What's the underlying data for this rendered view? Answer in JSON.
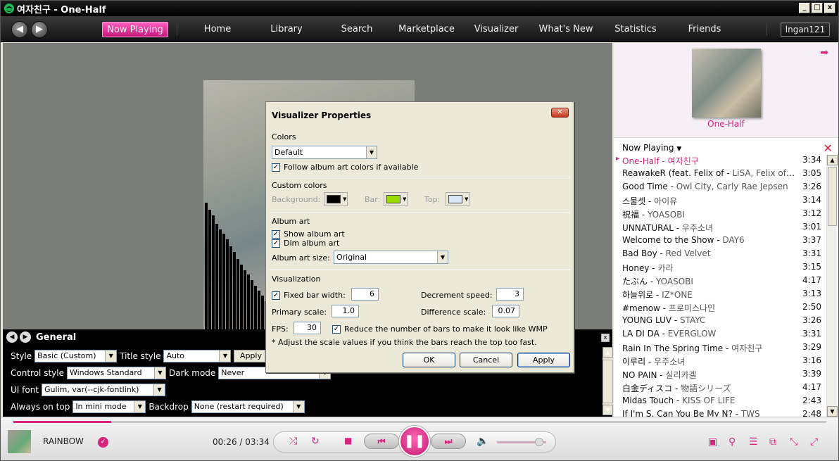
{
  "window": {
    "title": "여자친구 - One-Half",
    "controls": [
      "_",
      "□",
      "x"
    ]
  },
  "nav": {
    "back": "◀",
    "forward": "▶",
    "tabs": [
      "Now Playing",
      "Home",
      "Library",
      "Search",
      "Marketplace",
      "Visualizer",
      "What's New",
      "Statistics",
      "Friends"
    ],
    "user": "lngan121"
  },
  "settings": {
    "title": "General",
    "style_label": "Style",
    "style_value": "Basic (Custom)",
    "title_style_label": "Title style",
    "title_style_value": "Auto",
    "apply_label": "Apply",
    "control_style_label": "Control style",
    "control_style_value": "Windows Standard",
    "dark_mode_label": "Dark mode",
    "dark_mode_value": "Never",
    "ui_font_label": "UI font",
    "ui_font_value": "Gulim, var(--cjk-fontlink)",
    "always_on_top_label": "Always on top",
    "always_on_top_value": "In mini mode",
    "backdrop_label": "Backdrop",
    "backdrop_value": "None (restart required)"
  },
  "sidebar": {
    "album_name": "One-Half",
    "now_playing_label": "Now Playing",
    "tracks": [
      {
        "title": "One-Half",
        "artist": "여자친구",
        "duration": "3:34"
      },
      {
        "title": "ReawakeR (feat. Felix of",
        "artist": "LiSA, Felix of Stray Kids",
        "duration": "3:05"
      },
      {
        "title": "Good Time",
        "artist": "Owl City, Carly Rae Jepsen",
        "duration": "3:26"
      },
      {
        "title": "스물셋",
        "artist": "아이유",
        "duration": "3:14"
      },
      {
        "title": "祝福",
        "artist": "YOASOBI",
        "duration": "3:12"
      },
      {
        "title": "UNNATURAL",
        "artist": "우주소녀",
        "duration": "3:01"
      },
      {
        "title": "Welcome to the Show",
        "artist": "DAY6",
        "duration": "3:37"
      },
      {
        "title": "Bad Boy",
        "artist": "Red Velvet",
        "duration": "3:31"
      },
      {
        "title": "Honey",
        "artist": "카라",
        "duration": "3:15"
      },
      {
        "title": "たぶん",
        "artist": "YOASOBI",
        "duration": "4:17"
      },
      {
        "title": "하늘위로",
        "artist": "IZ*ONE",
        "duration": "3:13"
      },
      {
        "title": "#menow",
        "artist": "프로미스나인",
        "duration": "2:50"
      },
      {
        "title": "YOUNG LUV",
        "artist": "STAYC",
        "duration": "3:26"
      },
      {
        "title": "LA DI DA",
        "artist": "EVERGLOW",
        "duration": "3:31"
      },
      {
        "title": "Rain In The Spring Time",
        "artist": "여자친구",
        "duration": "3:29"
      },
      {
        "title": "이루리",
        "artist": "우주소녀",
        "duration": "3:16"
      },
      {
        "title": "NO PAIN",
        "artist": "실리카겔",
        "duration": "3:39"
      },
      {
        "title": "白金ディスコ",
        "artist": "物語シリーズ",
        "duration": "4:17"
      },
      {
        "title": "Midas Touch",
        "artist": "KISS OF LIFE",
        "duration": "2:43"
      },
      {
        "title": "If I'm S, Can You Be My N?",
        "artist": "TWS",
        "duration": "2:48"
      }
    ]
  },
  "player": {
    "song": "RAINBOW",
    "time": "00:26 / 03:34",
    "progress_fraction": 0.12,
    "volume_fraction": 0.85
  },
  "dialog": {
    "title": "Visualizer Properties",
    "colors_section": "Colors",
    "colors_value": "Default",
    "follow_album": "Follow album art colors if available",
    "custom_colors_section": "Custom colors",
    "background_label": "Background:",
    "bar_label": "Bar:",
    "top_label": "Top:",
    "background_color": "#000000",
    "bar_color": "#99dd00",
    "top_color": "#d8e6f8",
    "album_art_section": "Album art",
    "show_album_art": "Show album art",
    "dim_album_art": "Dim album art",
    "album_art_size_label": "Album art size:",
    "album_art_size_value": "Original",
    "visualization_section": "Visualization",
    "fixed_bar_width": "Fixed bar width:",
    "fixed_bar_width_value": "6",
    "decrement_speed": "Decrement speed:",
    "decrement_speed_value": "3",
    "primary_scale": "Primary scale:",
    "primary_scale_value": "1.0",
    "difference_scale": "Difference scale:",
    "difference_scale_value": "0.07",
    "fps": "FPS:",
    "fps_value": "30",
    "reduce_bars": "Reduce the number of bars to make it look like WMP",
    "note": "* Adjust the scale values if you think the bars reach the top too fast.",
    "ok": "OK",
    "cancel": "Cancel",
    "apply": "Apply"
  },
  "colors": {
    "accent": "#d6247f",
    "active_tab": "#e83a9c"
  }
}
